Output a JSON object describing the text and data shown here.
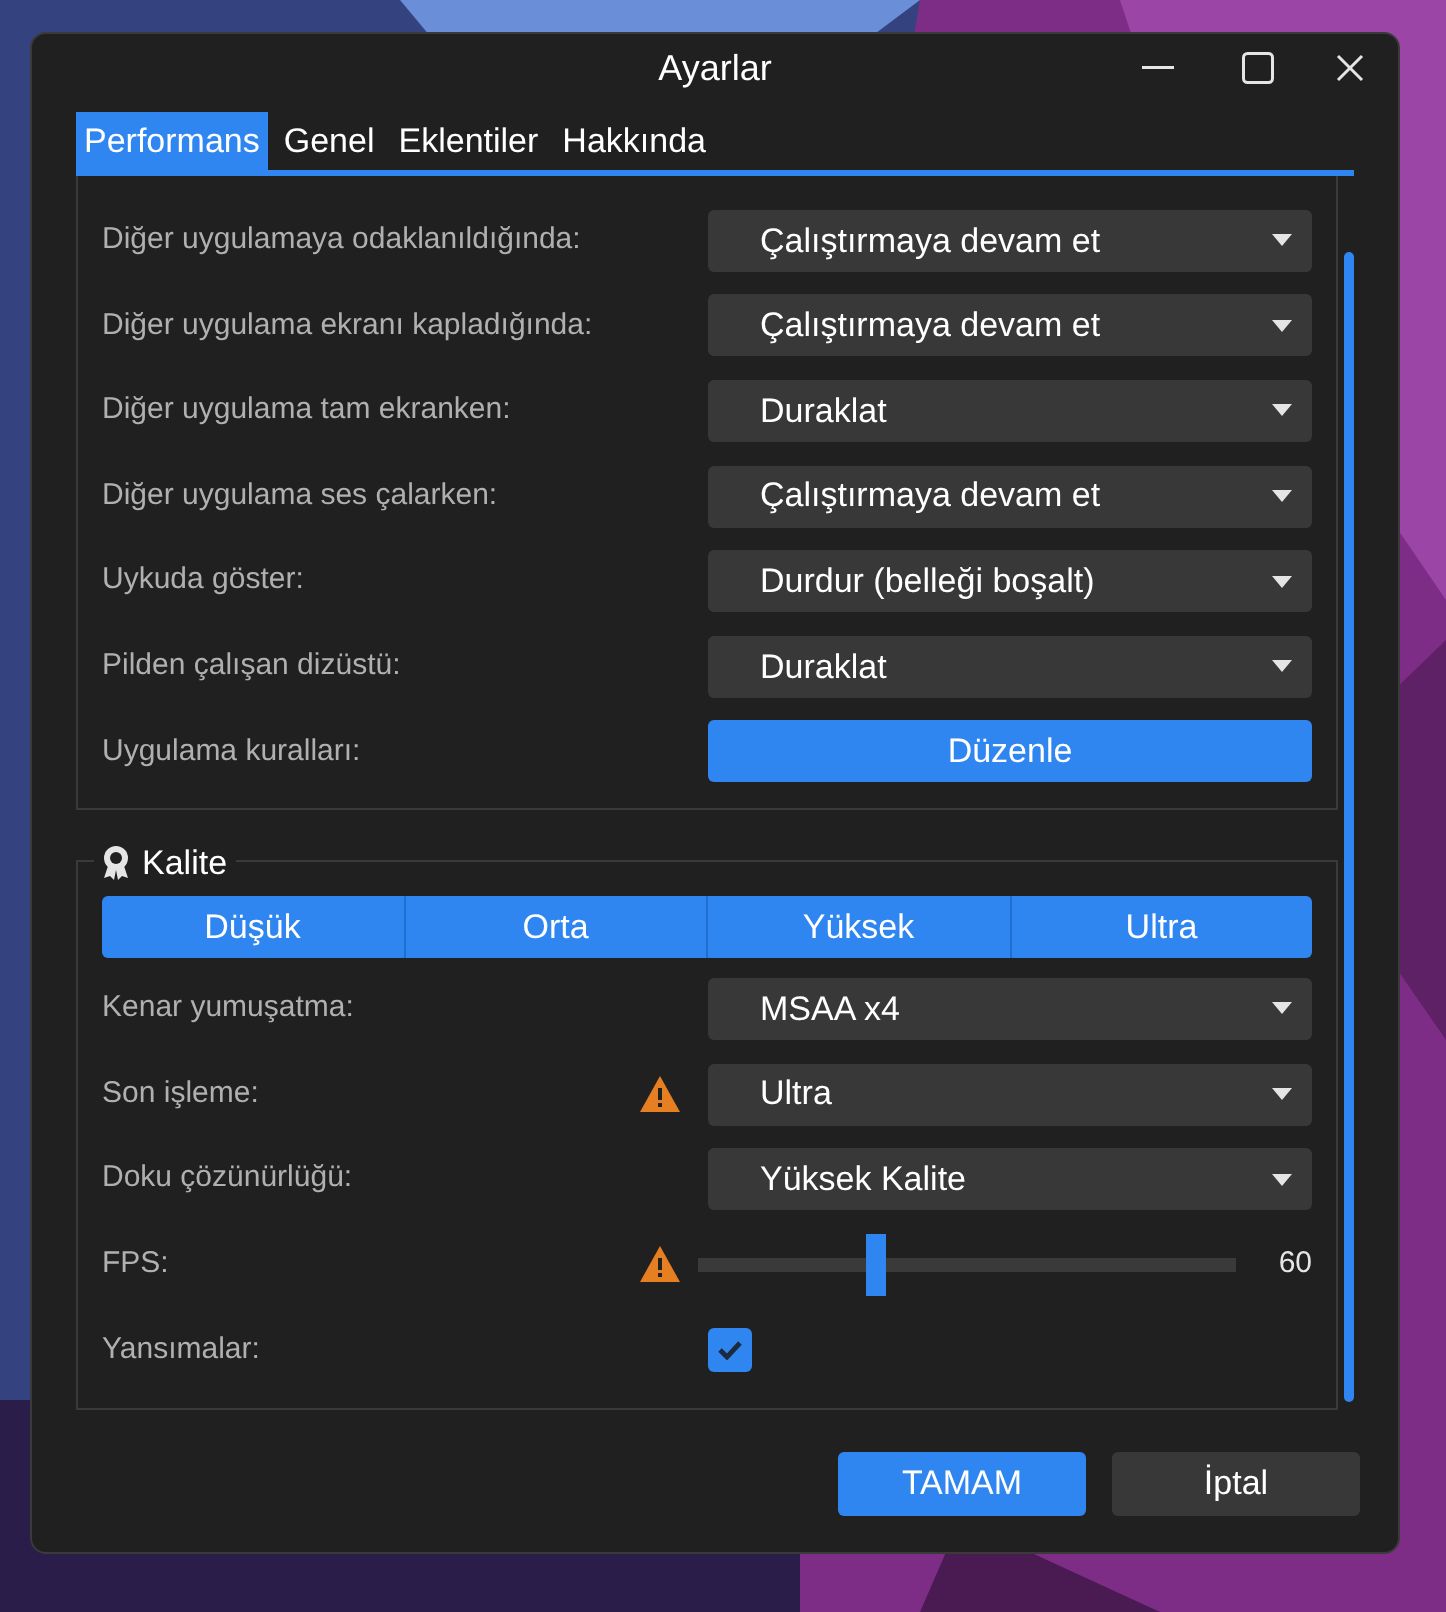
{
  "window": {
    "title": "Ayarlar"
  },
  "tabs": [
    {
      "label": "Performans",
      "selected": true
    },
    {
      "label": "Genel",
      "selected": false
    },
    {
      "label": "Eklentiler",
      "selected": false
    },
    {
      "label": "Hakkında",
      "selected": false
    }
  ],
  "playback": {
    "rows": [
      {
        "label": "Diğer uygulamaya odaklanıldığında:",
        "kind": "dropdown",
        "value": "Çalıştırmaya devam et"
      },
      {
        "label": "Diğer uygulama ekranı kapladığında:",
        "kind": "dropdown",
        "value": "Çalıştırmaya devam et"
      },
      {
        "label": "Diğer uygulama tam ekranken:",
        "kind": "dropdown",
        "value": "Duraklat"
      },
      {
        "label": "Diğer uygulama ses çalarken:",
        "kind": "dropdown",
        "value": "Çalıştırmaya devam et"
      },
      {
        "label": "Uykuda göster:",
        "kind": "dropdown",
        "value": "Durdur (belleği boşalt)"
      },
      {
        "label": "Pilden çalışan dizüstü:",
        "kind": "dropdown",
        "value": "Duraklat"
      },
      {
        "label": "Uygulama kuralları:",
        "kind": "button",
        "value": "Düzenle"
      }
    ]
  },
  "quality": {
    "title": "Kalite",
    "presets": [
      "Düşük",
      "Orta",
      "Yüksek",
      "Ultra"
    ],
    "rows": [
      {
        "label": "Kenar yumuşatma:",
        "kind": "dropdown",
        "warning": false,
        "value": "MSAA x4"
      },
      {
        "label": "Son işleme:",
        "kind": "dropdown",
        "warning": true,
        "value": "Ultra"
      },
      {
        "label": "Doku çözünürlüğü:",
        "kind": "dropdown",
        "warning": false,
        "value": "Yüksek Kalite"
      },
      {
        "label": "FPS:",
        "kind": "slider",
        "warning": true,
        "level": 0.33,
        "reading": "60"
      },
      {
        "label": "Yansımalar:",
        "kind": "checkbox",
        "warning": false,
        "checked": true
      }
    ]
  },
  "buttons": [
    {
      "label": "TAMAM",
      "kind": "primary"
    },
    {
      "label": "İptal",
      "kind": "secondary"
    }
  ]
}
